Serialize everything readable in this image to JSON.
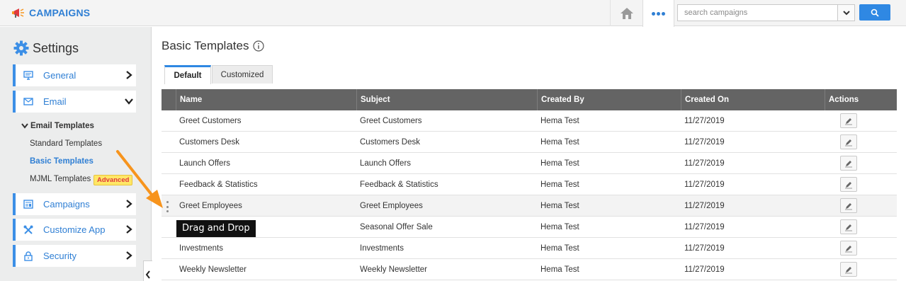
{
  "app": {
    "title": "CAMPAIGNS"
  },
  "search": {
    "placeholder": "search campaigns"
  },
  "sidebar": {
    "title": "Settings",
    "items": [
      {
        "label": "General",
        "icon": "monitor-icon"
      },
      {
        "label": "Email",
        "icon": "envelope-icon"
      },
      {
        "label": "Campaigns",
        "icon": "campaigns-icon"
      },
      {
        "label": "Customize App",
        "icon": "tools-icon"
      },
      {
        "label": "Security",
        "icon": "lock-icon"
      }
    ],
    "email_templates": {
      "heading": "Email Templates",
      "links": [
        "Standard Templates",
        "Basic Templates",
        "MJML Templates"
      ],
      "badge": "Advanced"
    }
  },
  "main": {
    "title": "Basic Templates",
    "tabs": [
      "Default",
      "Customized"
    ],
    "columns": [
      "Name",
      "Subject",
      "Created By",
      "Created On",
      "Actions"
    ],
    "rows": [
      [
        "Greet Customers",
        "Greet Customers",
        "Hema Test",
        "11/27/2019"
      ],
      [
        "Customers Desk",
        "Customers Desk",
        "Hema Test",
        "11/27/2019"
      ],
      [
        "Launch Offers",
        "Launch Offers",
        "Hema Test",
        "11/27/2019"
      ],
      [
        "Feedback & Statistics",
        "Feedback & Statistics",
        "Hema Test",
        "11/27/2019"
      ],
      [
        "Greet Employees",
        "Greet Employees",
        "Hema Test",
        "11/27/2019"
      ],
      [
        "",
        "Seasonal Offer Sale",
        "Hema Test",
        "11/27/2019"
      ],
      [
        "Investments",
        "Investments",
        "Hema Test",
        "11/27/2019"
      ],
      [
        "Weekly Newsletter",
        "Weekly Newsletter",
        "Hema Test",
        "11/27/2019"
      ]
    ],
    "tooltip": "Drag and Drop"
  },
  "colors": {
    "accent": "#2f7fd4",
    "header_bg": "#646464",
    "arrow": "#f7941d"
  }
}
